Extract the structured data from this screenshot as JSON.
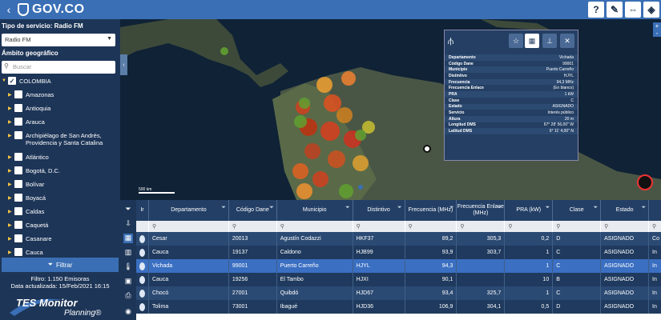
{
  "topbar": {
    "brand": "GOV.CO",
    "back_icon": "chevron-left-icon",
    "right_buttons": [
      {
        "name": "help-button",
        "glyph": "?"
      },
      {
        "name": "edit-button",
        "glyph": "✎"
      },
      {
        "name": "resize-button",
        "glyph": "⇔"
      },
      {
        "name": "layers-button",
        "glyph": "◈"
      }
    ]
  },
  "sidebar": {
    "service_label": "Tipo de servicio: Radio FM",
    "service_select": "Radio FM",
    "scope_label": "Ámbito geográfico",
    "search_placeholder": "Buscar",
    "tree": [
      {
        "label": "COLOMBIA",
        "checked": true,
        "level": 0
      },
      {
        "label": "Amazonas",
        "checked": false,
        "level": 1
      },
      {
        "label": "Antioquia",
        "checked": false,
        "level": 1
      },
      {
        "label": "Arauca",
        "checked": false,
        "level": 1
      },
      {
        "label": "Archipiélago de San Andrés,",
        "label2": "Providencia y Santa Catalina",
        "checked": false,
        "level": 1
      },
      {
        "label": "Atlántico",
        "checked": false,
        "level": 1
      },
      {
        "label": "Bogotá, D.C.",
        "checked": false,
        "level": 1
      },
      {
        "label": "Bolívar",
        "checked": false,
        "level": 1
      },
      {
        "label": "Boyacá",
        "checked": false,
        "level": 1
      },
      {
        "label": "Caldas",
        "checked": false,
        "level": 1
      },
      {
        "label": "Caquetá",
        "checked": false,
        "level": 1
      },
      {
        "label": "Casanare",
        "checked": false,
        "level": 1
      },
      {
        "label": "Cauca",
        "checked": false,
        "level": 1
      }
    ],
    "filter_button": "Filtrar",
    "filter_info": "Filtro: 1.150 Emisoras",
    "updated_info": "Data actualizada: 15/Feb/2021 16:15",
    "logo_main": "TES Monitor",
    "logo_sub": "Planning®"
  },
  "map": {
    "scale_label": "500 km",
    "zoom_in": "+",
    "zoom_out": "-"
  },
  "popup": {
    "rows": [
      {
        "k": "Departamento",
        "v": "Vichada"
      },
      {
        "k": "Código Dane",
        "v": "99001"
      },
      {
        "k": "Municipio",
        "v": "Puerto Carreño"
      },
      {
        "k": "Distintivo",
        "v": "HJYL"
      },
      {
        "k": "Frecuencia",
        "v": "94,3 MHz"
      },
      {
        "k": "Frecuencia Enlace",
        "v": "(En blanco)"
      },
      {
        "k": "PRA",
        "v": "1 kW"
      },
      {
        "k": "Clase",
        "v": "C"
      },
      {
        "k": "Estado",
        "v": "ASIGNADO"
      },
      {
        "k": "Servicio",
        "v": "Interés público"
      },
      {
        "k": "Altura",
        "v": "20 m"
      },
      {
        "k": "Longitud DMS",
        "v": "67° 28' 56,00\" W"
      },
      {
        "k": "Latitud DMS",
        "v": "6° 11' 4,00\" N"
      }
    ]
  },
  "table": {
    "columns": [
      "Ir",
      "Departamento",
      "Código Dane",
      "Municipio",
      "Distintivo",
      "Frecuencia (MHz)",
      "Frecuencia Enlace (MHz)",
      "PRA (kW)",
      "Clase",
      "Estado",
      ""
    ],
    "rows": [
      [
        "Cesar",
        "20013",
        "Agustín Codazzi",
        "HKF37",
        "89,2",
        "305,3",
        "0,2",
        "D",
        "ASIGNADO",
        "Co"
      ],
      [
        "Cauca",
        "19137",
        "Caldono",
        "HJB99",
        "93,9",
        "303,7",
        "1",
        "C",
        "ASIGNADO",
        "In"
      ],
      [
        "Vichada",
        "99001",
        "Puerto Carreño",
        "HJYL",
        "94,3",
        "",
        "1",
        "C",
        "ASIGNADO",
        "In"
      ],
      [
        "Cauca",
        "19256",
        "El Tambo",
        "HJXI",
        "90,1",
        "",
        "10",
        "B",
        "ASIGNADO",
        "In"
      ],
      [
        "Chocó",
        "27001",
        "Quibdó",
        "HJD67",
        "93,4",
        "325,7",
        "1",
        "C",
        "ASIGNADO",
        "In"
      ],
      [
        "Tolima",
        "73001",
        "Ibagué",
        "HJD36",
        "106,9",
        "304,1",
        "0,5",
        "D",
        "ASIGNADO",
        "In"
      ]
    ]
  }
}
